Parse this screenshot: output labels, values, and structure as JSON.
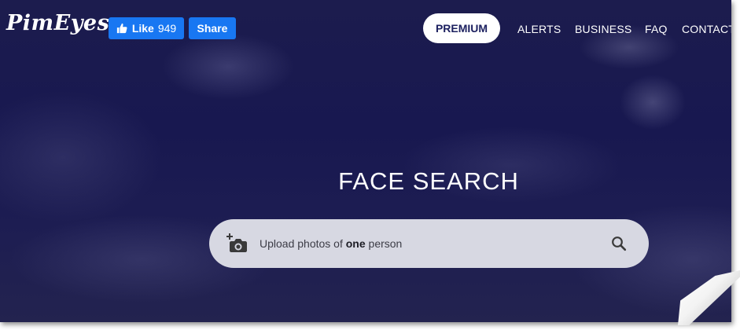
{
  "header": {
    "logo_text": "PimEyes",
    "like_label": "Like",
    "like_count": "949",
    "share_label": "Share",
    "premium_label": "PREMIUM",
    "nav": [
      "ALERTS",
      "BUSINESS",
      "FAQ",
      "CONTACT"
    ]
  },
  "hero": {
    "title": "FACE SEARCH",
    "search_prefix": "Upload photos of ",
    "search_emphasis": "one",
    "search_suffix": " person"
  },
  "icons": {
    "like": "thumbs-up-icon",
    "upload": "add-camera-icon",
    "search": "search-icon"
  },
  "colors": {
    "facebook": "#1877f2",
    "background": "#1c1c4e",
    "premium_text": "#1d2160",
    "search_bg": "#d7d8e2"
  }
}
